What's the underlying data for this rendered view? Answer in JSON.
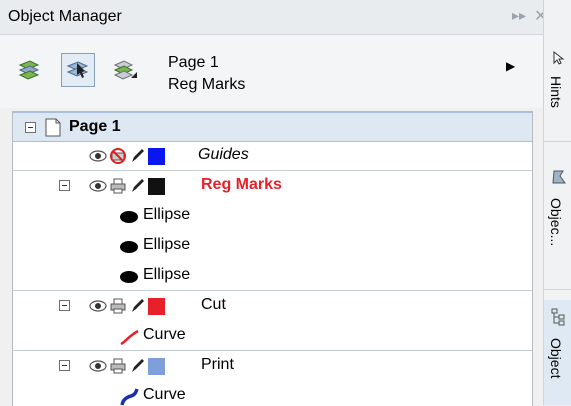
{
  "panel": {
    "title": "Object Manager",
    "pin_icon": "pin-icon",
    "close_icon": "close-icon"
  },
  "toolbar": {
    "page_name": "Page 1",
    "layer_name": "Reg Marks",
    "buttons": [
      "show-object-properties-icon",
      "edit-across-layers-icon",
      "layer-manager-view-icon"
    ],
    "flyout_icon": "flyout-arrow-icon"
  },
  "tree": {
    "page": {
      "label": "Page 1"
    },
    "layers": [
      {
        "label": "Guides",
        "color": "#0a16f0"
      },
      {
        "label": "Reg Marks",
        "color": "#111111",
        "label_color": "#e8202a"
      },
      {
        "label": "Cut",
        "color": "#e8202a"
      },
      {
        "label": "Print",
        "color": "#7f9fdb"
      }
    ],
    "objects": {
      "reg_marks": [
        "Ellipse",
        "Ellipse",
        "Ellipse"
      ],
      "cut": [
        "Curve"
      ],
      "print": [
        "Curve"
      ]
    }
  },
  "tabs": [
    {
      "label": "Hints"
    },
    {
      "label": "Objec..."
    },
    {
      "label": "Object"
    }
  ]
}
